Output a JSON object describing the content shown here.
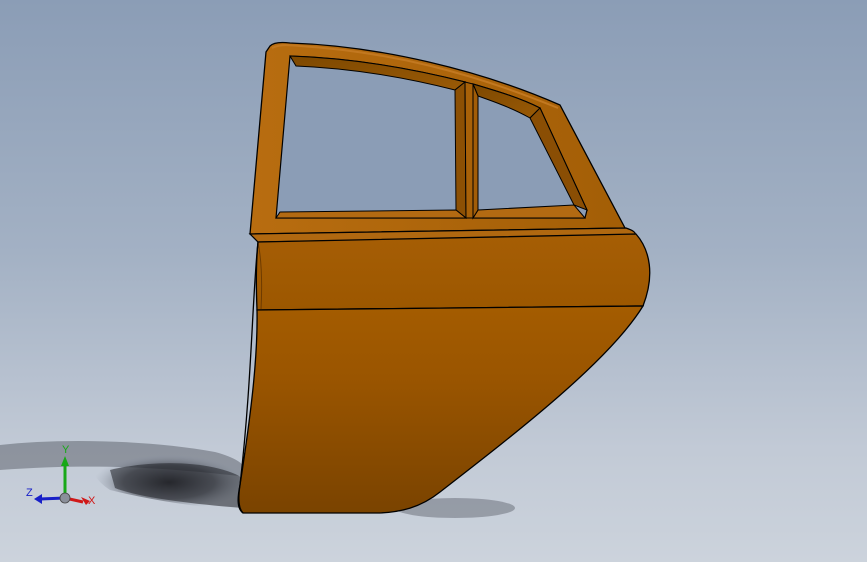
{
  "viewport": {
    "background_top": "#8b9db6",
    "background_bottom": "#ccd3dc"
  },
  "model": {
    "part": "rear-car-door",
    "body_color": "#a05a00",
    "frame_color": "#b46a10",
    "edge_color": "#000000"
  },
  "triad": {
    "x_label": "X",
    "y_label": "Y",
    "z_label": "Z",
    "x_color": "#d01818",
    "y_color": "#18a818",
    "z_color": "#1820c8"
  }
}
